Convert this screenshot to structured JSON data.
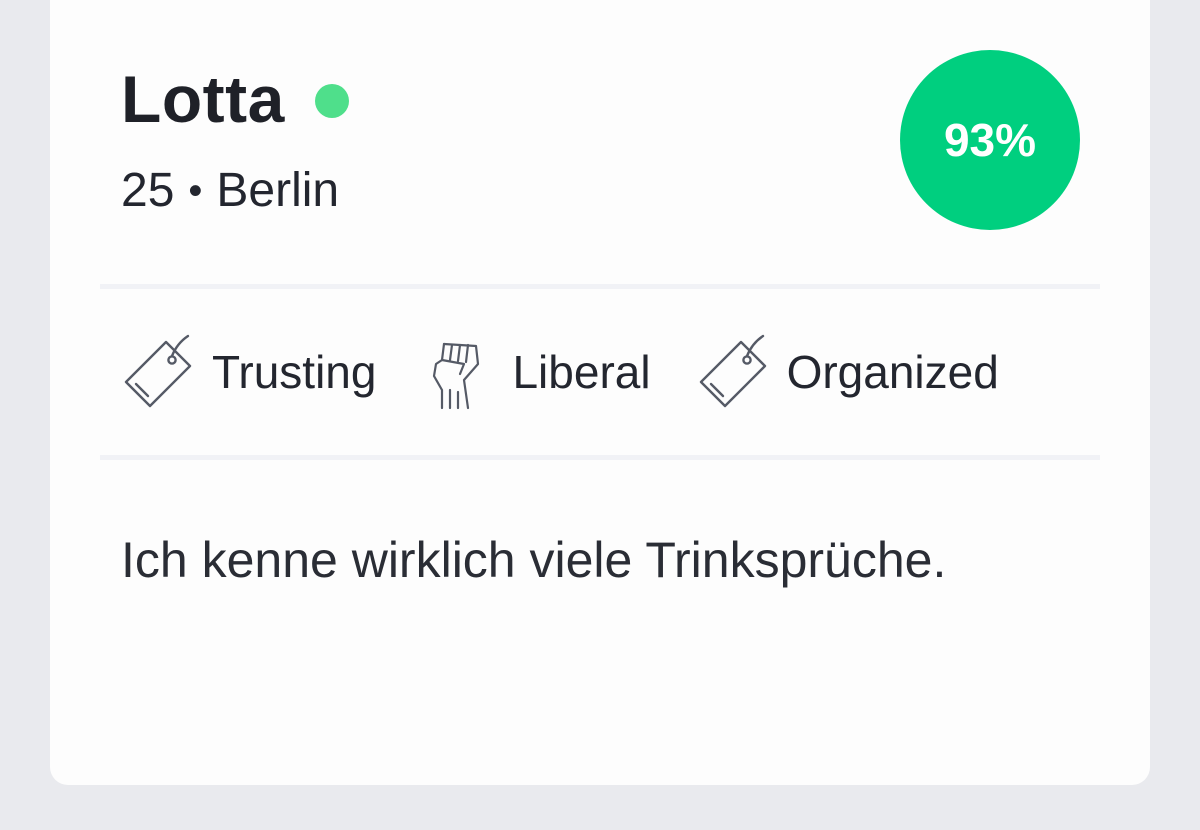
{
  "profile": {
    "name": "Lotta",
    "age": "25",
    "separator": "•",
    "city": "Berlin",
    "online_status_color": "#4fdf8b",
    "match_percent": "93%",
    "match_color": "#00cf7f",
    "traits": [
      {
        "label": "Trusting",
        "icon": "tag-icon"
      },
      {
        "label": "Liberal",
        "icon": "raised-fist-icon"
      },
      {
        "label": "Organized",
        "icon": "tag-icon"
      }
    ],
    "bio": "Ich kenne wirklich viele Trinksprüche."
  },
  "colors": {
    "background": "#e9eaee",
    "card": "#fdfdfd",
    "text": "#23262f",
    "divider": "#f1f2f6"
  }
}
